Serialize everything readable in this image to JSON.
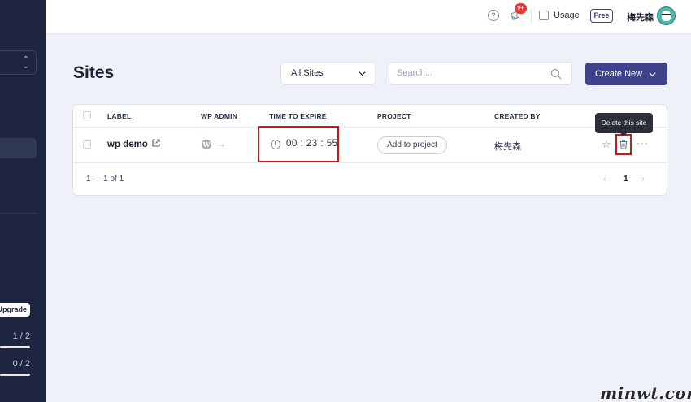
{
  "sidebar": {
    "upgrade_label": "Upgrade",
    "usage_1": "1 / 2",
    "usage_2": "0 / 2"
  },
  "topbar": {
    "help_icon": "question-circle-icon",
    "notification_badge": "9+",
    "usage_label": "Usage",
    "plan_badge": "Free",
    "user_name": "梅先森"
  },
  "main": {
    "title": "Sites",
    "filter_selected": "All Sites",
    "search_placeholder": "Search...",
    "create_button": "Create New"
  },
  "table": {
    "headers": [
      "LABEL",
      "WP ADMIN",
      "TIME TO EXPIRE",
      "PROJECT",
      "CREATED BY"
    ],
    "rows": [
      {
        "label": "wp demo",
        "wp_icon_letter": "W",
        "time_to_expire": "00 : 23 : 55",
        "project_action": "Add to project",
        "created_by": "梅先森"
      }
    ],
    "pagination_summary": "1 — 1 of 1",
    "current_page": "1"
  },
  "tooltip": {
    "text": "Delete this site"
  },
  "watermark": "minwt.com",
  "colors": {
    "sidebar_bg": "#1d2540",
    "accent": "#3e438c",
    "highlight_box": "#c41a1a",
    "badge_red": "#e53935"
  }
}
